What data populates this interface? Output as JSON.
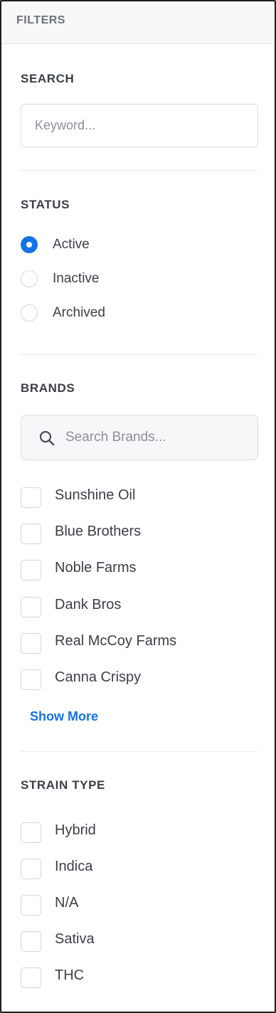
{
  "header": {
    "title": "FILTERS"
  },
  "search": {
    "title": "SEARCH",
    "placeholder": "Keyword..."
  },
  "status": {
    "title": "STATUS",
    "options": [
      {
        "label": "Active",
        "checked": true
      },
      {
        "label": "Inactive",
        "checked": false
      },
      {
        "label": "Archived",
        "checked": false
      }
    ]
  },
  "brands": {
    "title": "BRANDS",
    "search_placeholder": "Search Brands...",
    "items": [
      {
        "label": "Sunshine Oil",
        "checked": false
      },
      {
        "label": "Blue Brothers",
        "checked": false
      },
      {
        "label": "Noble Farms",
        "checked": false
      },
      {
        "label": "Dank Bros",
        "checked": false
      },
      {
        "label": "Real McCoy Farms",
        "checked": false
      },
      {
        "label": "Canna Crispy",
        "checked": false
      }
    ],
    "show_more_label": "Show More"
  },
  "strain_type": {
    "title": "STRAIN TYPE",
    "items": [
      {
        "label": "Hybrid",
        "checked": false
      },
      {
        "label": "Indica",
        "checked": false
      },
      {
        "label": "N/A",
        "checked": false
      },
      {
        "label": "Sativa",
        "checked": false
      },
      {
        "label": "THC",
        "checked": false
      }
    ]
  },
  "colors": {
    "accent": "#1473e6",
    "text": "#3a3f47",
    "muted": "#6b7178",
    "border": "#d9dce0"
  }
}
